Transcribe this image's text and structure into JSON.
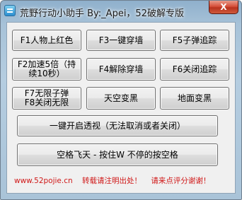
{
  "window": {
    "title": "荒野行动小助手  By:_Apei，52破解专版",
    "close_label": "X"
  },
  "buttons": {
    "f1": "F1人物上红色",
    "f3": "F3一键穿墙",
    "f5": "F5子弹追踪",
    "f2_line1": "F2加速5倍（持",
    "f2_line2": "续10秒）",
    "f4": "F4解除穿墙",
    "f6": "F6关闭追踪",
    "f7_line1": "F7无限子弹",
    "f7_line2": "F8关闭无限",
    "sky": "天空变黑",
    "ground": "地面变黑",
    "xray": "一键开启透视（无法取消或者关闭）",
    "fly": "空格飞天 - 按住W 不停的按空格"
  },
  "footer": {
    "site": "www.52pojie.cn",
    "notice": "转载请注明出处！",
    "thanks": "请来点评分谢谢！"
  },
  "colors": {
    "footer_text": "#d01818",
    "close_button": "#c8442c"
  }
}
